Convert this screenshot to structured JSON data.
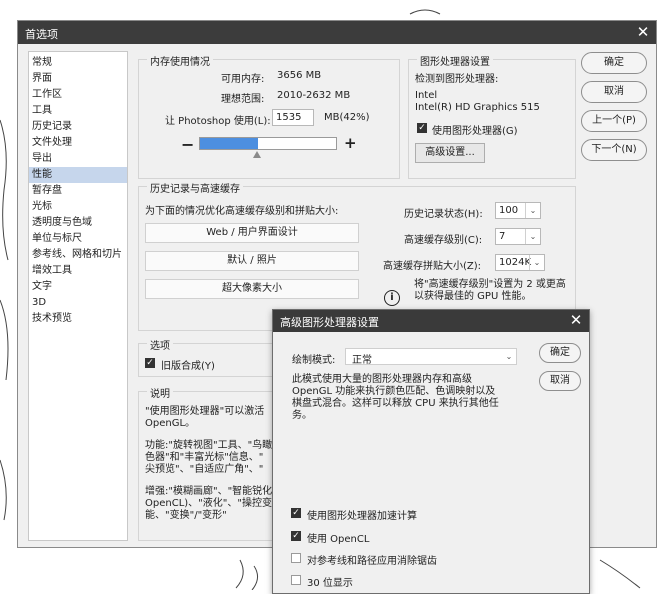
{
  "colors": {
    "titlebar": "#3c3c3c",
    "panel": "#f0f0f0",
    "selection": "#c6d6ec",
    "slider_fill": "#4d8fe0"
  },
  "main_dialog": {
    "title": "首选项",
    "close_glyph": "✕"
  },
  "nav": {
    "items": [
      "常规",
      "界面",
      "工作区",
      "工具",
      "历史记录",
      "文件处理",
      "导出",
      "性能",
      "暂存盘",
      "光标",
      "透明度与色域",
      "单位与标尺",
      "参考线、网格和切片",
      "增效工具",
      "文字",
      "3D",
      "技术预览"
    ],
    "selected": "性能"
  },
  "memory": {
    "legend": "内存使用情况",
    "available_label": "可用内存:",
    "available_value": "3656 MB",
    "ideal_label": "理想范围:",
    "ideal_value": "2010-2632 MB",
    "use_label": "让 Photoshop 使用(L):",
    "use_value": "1535",
    "use_unit": "MB(42%)",
    "minus": "−",
    "plus": "+",
    "slider_fraction": 0.42
  },
  "gpu": {
    "legend": "图形处理器设置",
    "detected_label": "检测到图形处理器:",
    "vendor": "Intel",
    "model": "Intel(R) HD Graphics 515",
    "use_gpu_label": "使用图形处理器(G)",
    "use_gpu_checked": true,
    "advanced_button": "高级设置..."
  },
  "buttons": {
    "ok": "确定",
    "cancel": "取消",
    "prev": "上一个(P)",
    "next": "下一个(N)"
  },
  "history_cache": {
    "legend": "历史记录与高速缓存",
    "optimize_label": "为下面的情况优化高速缓存级别和拼贴大小:",
    "preset1": "Web / 用户界面设计",
    "preset2": "默认 / 照片",
    "preset3": "超大像素大小",
    "history_states_label": "历史记录状态(H):",
    "history_states_value": "100",
    "cache_levels_label": "高速缓存级别(C):",
    "cache_levels_value": "7",
    "tile_size_label": "高速缓存拼贴大小(Z):",
    "tile_size_value": "1024K",
    "info_text": "将\"高速缓存级别\"设置为 2 或更高以获得最佳的 GPU 性能。",
    "info_icon": "info-icon"
  },
  "options": {
    "legend": "选项",
    "legacy_label": "旧版合成(Y)",
    "legacy_checked": true
  },
  "description": {
    "legend": "说明",
    "p1_line1": "\"使用图形处理器\"可以激活",
    "p1_line2": "OpenGL。",
    "p2_line1": "功能:\"旋转视图\"工具、\"鸟瞰",
    "p2_line2": "色器\"和\"丰富光标\"信息、\"",
    "p2_line3": "尖预览\"、\"自适应广角\"、\"",
    "p3_line1": "增强:\"模糊画廊\"、\"智能锐化",
    "p3_line2": "OpenCL)、\"液化\"、\"操控变",
    "p3_line3": "能、\"变换\"/\"变形\""
  },
  "advanced_dialog": {
    "title": "高级图形处理器设置",
    "close_glyph": "✕",
    "mode_label": "绘制模式:",
    "mode_value": "正常",
    "ok": "确定",
    "cancel": "取消",
    "desc_line1": "此模式使用大量的图形处理器内存和高级",
    "desc_line2": "OpenGL 功能来执行颜色匹配、色调映射以及",
    "desc_line3": "棋盘式混合。这样可以释放 CPU 来执行其他任",
    "desc_line4": "务。",
    "opt1_label": "使用图形处理器加速计算",
    "opt1_checked": true,
    "opt2_label": "使用 OpenCL",
    "opt2_checked": true,
    "opt3_label": "对参考线和路径应用消除锯齿",
    "opt3_checked": false,
    "opt4_label": "30 位显示",
    "opt4_checked": false
  }
}
